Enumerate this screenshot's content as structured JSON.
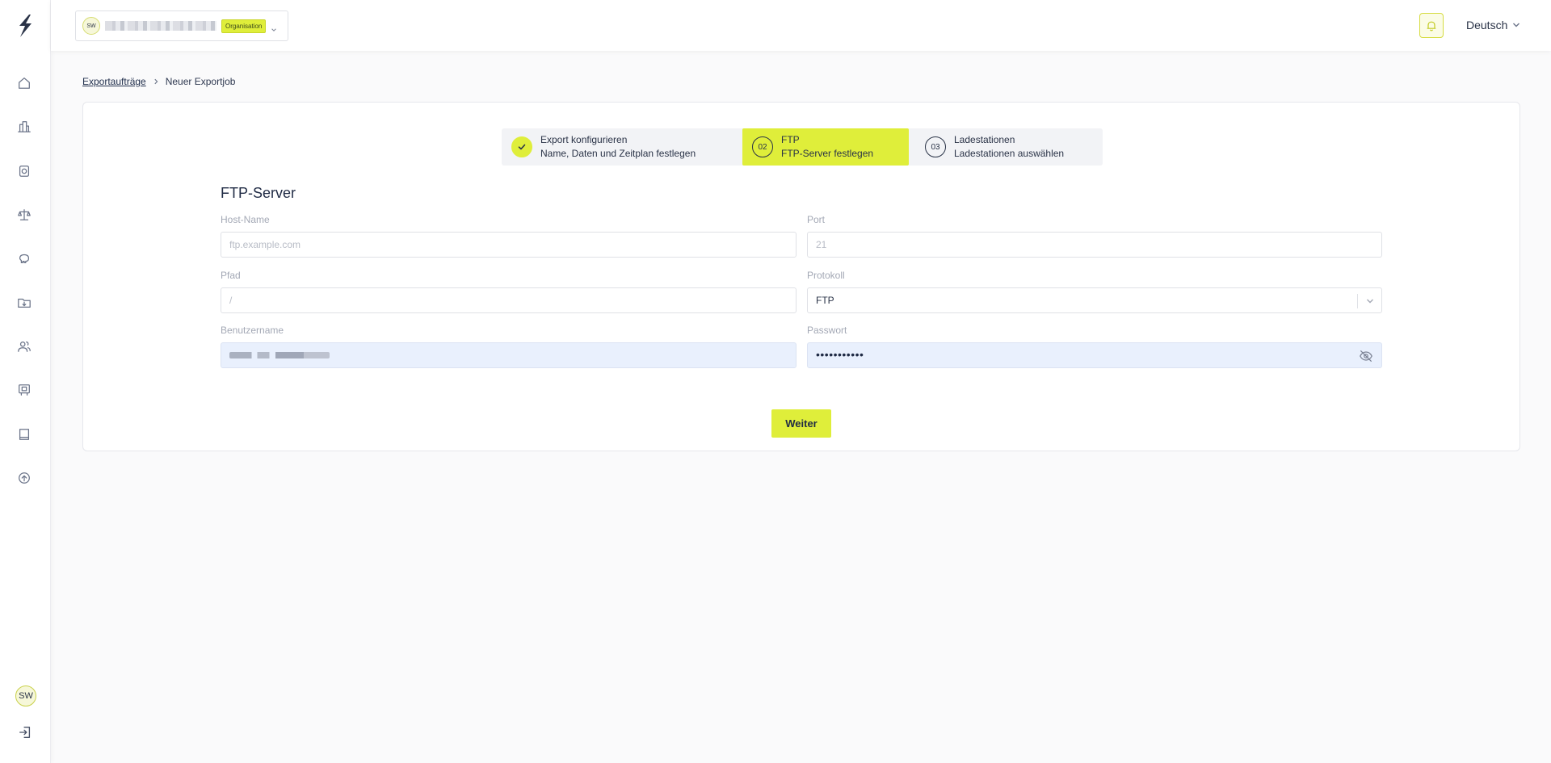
{
  "header": {
    "org": {
      "avatar_initials": "SW",
      "name": "",
      "badge": "Organisation"
    },
    "language": "Deutsch"
  },
  "sidebar": {
    "items": [
      {
        "icon": "home-icon"
      },
      {
        "icon": "building-icon"
      },
      {
        "icon": "charging-station-icon"
      },
      {
        "icon": "scale-icon"
      },
      {
        "icon": "piggy-bank-icon"
      },
      {
        "icon": "folder-download-icon"
      },
      {
        "icon": "users-icon"
      },
      {
        "icon": "cpu-card-icon"
      },
      {
        "icon": "book-icon"
      },
      {
        "icon": "upload-circle-icon"
      }
    ],
    "user_initials": "SW"
  },
  "breadcrumb": {
    "parent": "Exportaufträge",
    "current": "Neuer Exportjob"
  },
  "stepper": [
    {
      "number": "",
      "title": "Export konfigurieren",
      "subtitle": "Name, Daten und Zeitplan festlegen",
      "state": "done"
    },
    {
      "number": "02",
      "title": "FTP",
      "subtitle": "FTP-Server festlegen",
      "state": "active"
    },
    {
      "number": "03",
      "title": "Ladestationen",
      "subtitle": "Ladestationen auswählen",
      "state": "pending"
    }
  ],
  "form": {
    "title": "FTP-Server",
    "host": {
      "label": "Host-Name",
      "placeholder": "ftp.example.com",
      "value": ""
    },
    "port": {
      "label": "Port",
      "placeholder": "21",
      "value": ""
    },
    "path": {
      "label": "Pfad",
      "placeholder": "/",
      "value": ""
    },
    "protocol": {
      "label": "Protokoll",
      "value": "FTP"
    },
    "username": {
      "label": "Benutzername",
      "value": ""
    },
    "password": {
      "label": "Passwort",
      "value": "•••••••••••"
    },
    "submit_label": "Weiter"
  },
  "colors": {
    "accent": "#dfee3a",
    "text": "#1f2a44",
    "autofill": "#e9f0fd"
  }
}
